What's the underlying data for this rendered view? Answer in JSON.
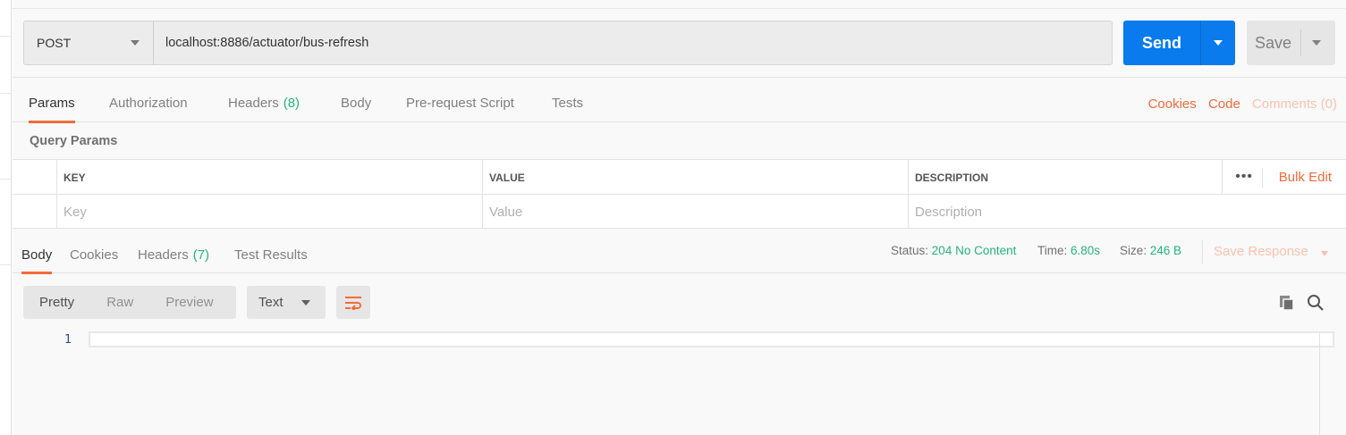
{
  "request": {
    "method": "POST",
    "url": "localhost:8886/actuator/bus-refresh",
    "send_label": "Send",
    "save_label": "Save"
  },
  "request_tabs": [
    {
      "label": "Params",
      "active": true
    },
    {
      "label": "Authorization"
    },
    {
      "label": "Headers",
      "count": "(8)"
    },
    {
      "label": "Body"
    },
    {
      "label": "Pre-request Script"
    },
    {
      "label": "Tests"
    }
  ],
  "right_links": {
    "cookies": "Cookies",
    "code": "Code",
    "comments": "Comments (0)"
  },
  "query_params": {
    "title": "Query Params",
    "headers": {
      "key": "KEY",
      "value": "VALUE",
      "description": "DESCRIPTION"
    },
    "placeholders": {
      "key": "Key",
      "value": "Value",
      "description": "Description"
    },
    "more": "•••",
    "bulk_edit": "Bulk Edit"
  },
  "response_tabs": [
    {
      "label": "Body",
      "active": true
    },
    {
      "label": "Cookies"
    },
    {
      "label": "Headers",
      "count": "(7)"
    },
    {
      "label": "Test Results"
    }
  ],
  "response_status": {
    "status_label": "Status:",
    "status_value": "204 No Content",
    "time_label": "Time:",
    "time_value": "6.80s",
    "size_label": "Size:",
    "size_value": "246 B",
    "save_response": "Save Response"
  },
  "view_modes": {
    "pretty": "Pretty",
    "raw": "Raw",
    "preview": "Preview",
    "format": "Text"
  },
  "editor": {
    "line_number": "1"
  },
  "colors": {
    "accent": "#f26b3a",
    "primary": "#097bed",
    "success": "#26b47f"
  }
}
